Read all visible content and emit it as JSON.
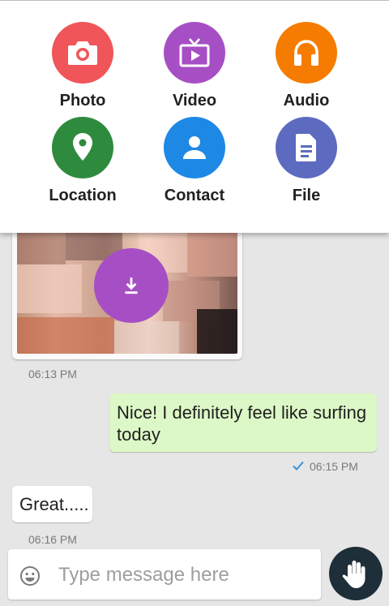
{
  "attach_menu": {
    "items": [
      {
        "label": "Photo",
        "icon": "camera-icon",
        "color": "#f0555a"
      },
      {
        "label": "Video",
        "icon": "tv-play-icon",
        "color": "#a64fc4"
      },
      {
        "label": "Audio",
        "icon": "headphones-icon",
        "color": "#f57c00"
      },
      {
        "label": "Location",
        "icon": "location-pin-icon",
        "color": "#2e8b3d"
      },
      {
        "label": "Contact",
        "icon": "contact-person-icon",
        "color": "#1e88e5"
      },
      {
        "label": "File",
        "icon": "document-icon",
        "color": "#5c6bc0"
      }
    ]
  },
  "messages": [
    {
      "type": "image",
      "direction": "incoming",
      "time": "06:13 PM",
      "action_icon": "download-icon",
      "action_color": "#a64fc4"
    },
    {
      "type": "text",
      "direction": "outgoing",
      "text": "Nice! I definitely feel like surfing today",
      "time": "06:15 PM",
      "status_icon": "check-icon",
      "bubble_color": "#dcf8c6"
    },
    {
      "type": "text",
      "direction": "incoming",
      "text": "Great.....",
      "time": "06:16 PM",
      "bubble_color": "#ffffff"
    }
  ],
  "composer": {
    "placeholder": "Type message here",
    "emoji_icon": "emoji-icon",
    "send_icon": "hand-wave-icon",
    "send_color": "#1f2f39"
  }
}
